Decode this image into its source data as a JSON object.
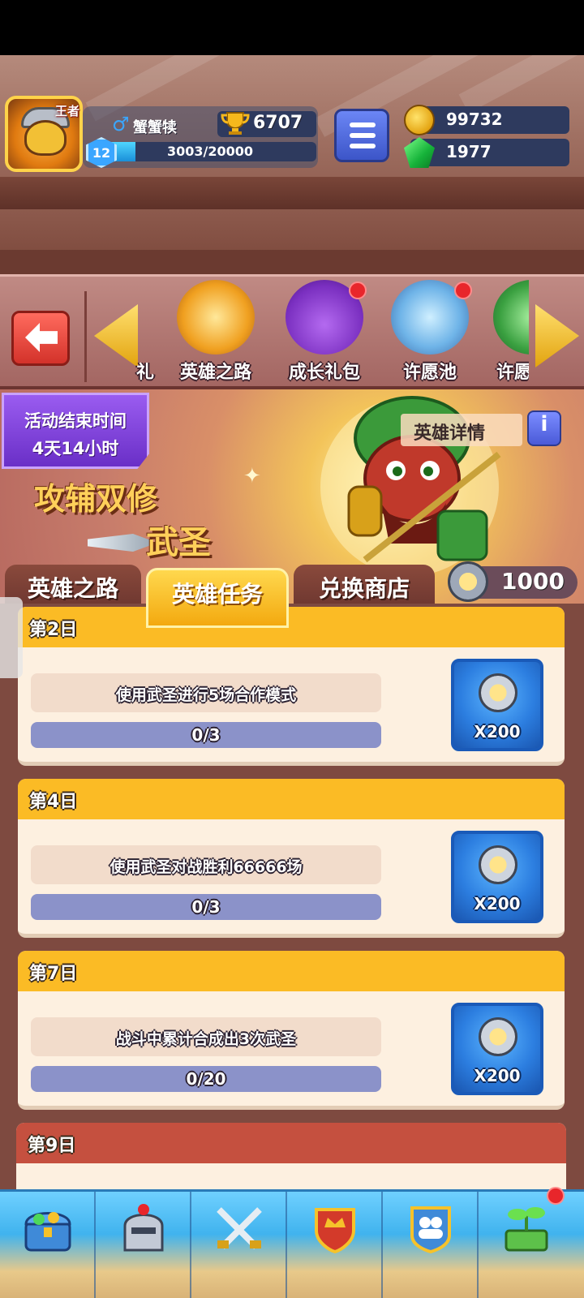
{
  "player": {
    "rank_badge": "王者",
    "name": "蟹蟹犊",
    "trophies": "6707",
    "level": "12",
    "xp_text": "3003/20000",
    "xp_fraction": 0.15
  },
  "currencies": {
    "gold": "99732",
    "gems": "1977"
  },
  "events": {
    "partial_left_label": "礼",
    "items": [
      {
        "label": "英雄之路",
        "has_badge": false
      },
      {
        "label": "成长礼包",
        "has_badge": true
      },
      {
        "label": "许愿池",
        "has_badge": true
      }
    ],
    "partial_right_label": "许愿"
  },
  "banner": {
    "timer_line1": "活动结束时间",
    "timer_line2": "4天14小时",
    "slogan": "攻辅双修",
    "hero_name": "武圣",
    "hero_detail_label": "英雄详情",
    "info_icon": "i",
    "token_count": "1000"
  },
  "tabs": [
    {
      "label": "英雄之路",
      "active": false
    },
    {
      "label": "英雄任务",
      "active": true
    },
    {
      "label": "兑换商店",
      "active": false
    }
  ],
  "tasks": [
    {
      "day": "第2日",
      "desc": "使用武圣进行5场合作模式",
      "progress": "0/3",
      "progress_fraction": 0,
      "reward": "X200"
    },
    {
      "day": "第4日",
      "desc": "使用武圣对战胜利66666场",
      "progress": "0/3",
      "progress_fraction": 0,
      "reward": "X200"
    },
    {
      "day": "第7日",
      "desc": "战斗中累计合成出3次武圣",
      "progress": "0/20",
      "progress_fraction": 0,
      "reward": "X200"
    },
    {
      "day": "第9日"
    }
  ],
  "bottom_nav": [
    {
      "icon": "treasure-chest-icon",
      "badge": false
    },
    {
      "icon": "knight-helmet-icon",
      "badge": false
    },
    {
      "icon": "crossed-swords-icon",
      "badge": false
    },
    {
      "icon": "crown-shield-icon",
      "badge": false
    },
    {
      "icon": "friends-icon",
      "badge": false
    },
    {
      "icon": "sprout-icon",
      "badge": true
    }
  ],
  "colors": {
    "tab_active": "#f3a90f",
    "task_header": "#fbbb25",
    "reward_button": "#2c7ee0",
    "progress_track": "#8b92c9"
  }
}
